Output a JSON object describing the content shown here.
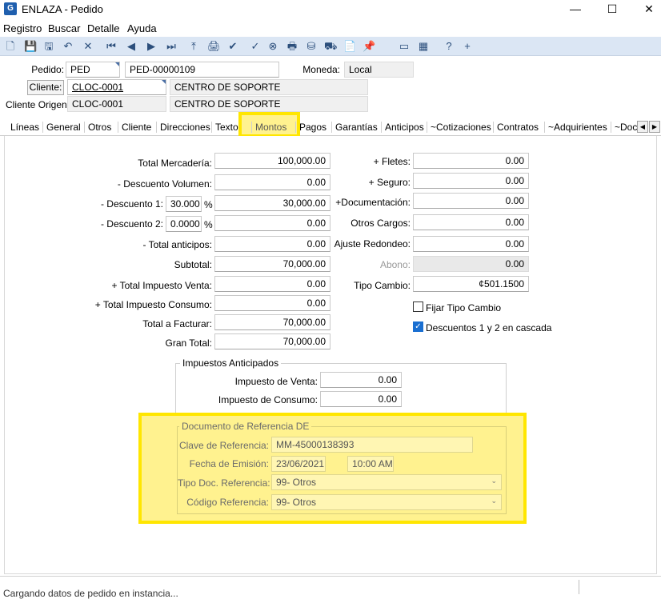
{
  "window": {
    "title": "ENLAZA - Pedido",
    "icon_text": "G",
    "controls": {
      "minimize": "—",
      "maximize": "☐",
      "close": "✕"
    }
  },
  "menu": {
    "items": [
      "Registro",
      "Buscar",
      "Detalle",
      "Ayuda"
    ]
  },
  "toolbar": {
    "icons": [
      "new-icon",
      "save-icon",
      "save-close-icon",
      "undo-icon",
      "delete-icon",
      "first-icon",
      "prev-icon",
      "next-icon",
      "last-icon",
      "upload-icon",
      "print-preview-icon",
      "approve-icon",
      "checkmark-icon",
      "cancel-icon",
      "printer-icon",
      "stamp-icon",
      "truck-icon",
      "document-icon",
      "pin-icon",
      "window-icon",
      "stats-icon",
      "help-icon",
      "add-icon"
    ],
    "glyphs": [
      "🗋",
      "💾",
      "🖫",
      "↶",
      "✕",
      "⏮",
      "◀",
      "▶",
      "⏭",
      "⤒",
      "🖨",
      "✔",
      "✓",
      "⊗",
      "🖶",
      "⛁",
      "⛟",
      "📄",
      "📌",
      "▭",
      "▦",
      "?",
      "+"
    ]
  },
  "header": {
    "pedido_label": "Pedido:",
    "pedido_type": "PED",
    "pedido_number": "PED-00000109",
    "moneda_label": "Moneda:",
    "moneda_value": "Local",
    "cliente_button": "Cliente:",
    "cliente_code": "CLOC-0001",
    "cliente_name": "CENTRO DE SOPORTE",
    "cliente_origen_label": "Cliente Origen:",
    "cliente_origen_code": "CLOC-0001",
    "cliente_origen_name": "CENTRO DE SOPORTE"
  },
  "tabs": {
    "items": [
      "Líneas",
      "General",
      "Otros",
      "Cliente",
      "Direcciones",
      "Texto",
      "Montos",
      "Pagos",
      "Garantías",
      "Anticipos",
      "~Cotizaciones",
      "Contratos",
      "~Adquirientes",
      "~Doc"
    ],
    "active": "Montos",
    "scroll_left": "◀",
    "scroll_right": "▶"
  },
  "amounts": {
    "total_mercaderia_label": "Total Mercadería:",
    "total_mercaderia": "100,000.00",
    "descuento_volumen_label": "- Descuento Volumen:",
    "descuento_volumen": "0.00",
    "descuento1_label": "- Descuento 1:",
    "descuento1_pct": "30.000",
    "descuento1": "30,000.00",
    "descuento2_label": "- Descuento 2:",
    "descuento2_pct": "0.0000",
    "descuento2": "0.00",
    "pct_symbol": "%",
    "total_anticipos_label": "- Total anticipos:",
    "total_anticipos": "0.00",
    "subtotal_label": "Subtotal:",
    "subtotal": "70,000.00",
    "impuesto_venta_label": "+ Total Impuesto Venta:",
    "impuesto_venta": "0.00",
    "impuesto_consumo_label": "+ Total Impuesto Consumo:",
    "impuesto_consumo": "0.00",
    "total_facturar_label": "Total a Facturar:",
    "total_facturar": "70,000.00",
    "gran_total_label": "Gran Total:",
    "gran_total": "70,000.00"
  },
  "charges": {
    "fletes_label": "+ Fletes:",
    "fletes": "0.00",
    "seguro_label": "+ Seguro:",
    "seguro": "0.00",
    "documentacion_label": "+Documentación:",
    "documentacion": "0.00",
    "otros_cargos_label": "Otros Cargos:",
    "otros_cargos": "0.00",
    "ajuste_label": "Ajuste Redondeo:",
    "ajuste": "0.00",
    "abono_label": "Abono:",
    "abono": "0.00",
    "tipo_cambio_label": "Tipo Cambio:",
    "tipo_cambio": "¢501.1500",
    "fijar_tipo_cambio": "Fijar Tipo Cambio",
    "fijar_checked": false,
    "cascada": "Descuentos 1 y 2 en cascada",
    "cascada_checked": true,
    "check_glyph": "✓"
  },
  "impuestos_anticipados": {
    "title": "Impuestos Anticipados",
    "venta_label": "Impuesto de Venta:",
    "venta": "0.00",
    "consumo_label": "Impuesto de Consumo:",
    "consumo": "0.00"
  },
  "documento_referencia": {
    "title": "Documento de Referencia DE",
    "clave_label": "Clave de Referencia:",
    "clave": "MM-45000138393",
    "fecha_label": "Fecha de Emisión:",
    "fecha": "23/06/2021",
    "hora": "10:00 AM",
    "tipo_doc_label": "Tipo Doc. Referencia:",
    "tipo_doc": "99- Otros",
    "codigo_label": "Código Referencia:",
    "codigo": "99- Otros",
    "dropdown_glyph": "⌄"
  },
  "status": {
    "text": "Cargando datos de pedido en instancia..."
  },
  "colors": {
    "highlight": "#ffe600",
    "highlight_fill": "#fff28f",
    "toolbar": "#dbe6f4",
    "check": "#1a6fd1"
  }
}
